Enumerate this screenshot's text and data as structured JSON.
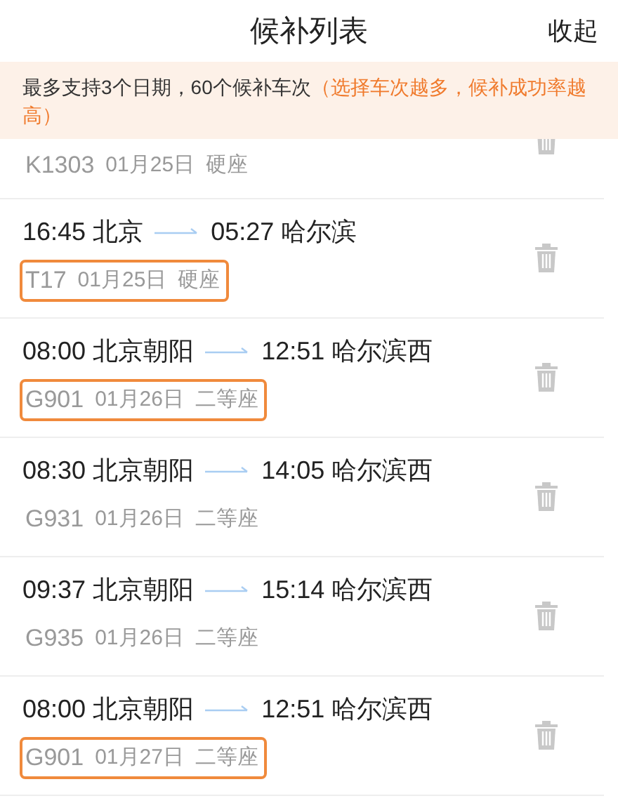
{
  "header": {
    "title": "候补列表",
    "action": "收起"
  },
  "notice": {
    "text": "最多支持3个日期，60个候补车次",
    "hint": "（选择车次越多，候补成功率越高）"
  },
  "trains": [
    {
      "kind": "partial",
      "train": "K1303",
      "date": "01月25日",
      "seat": "硬座",
      "highlighted": false
    },
    {
      "kind": "full",
      "depart_time": "16:45",
      "from": "北京",
      "arrive_time": "05:27",
      "to": "哈尔滨",
      "train": "T17",
      "date": "01月25日",
      "seat": "硬座",
      "highlighted": true
    },
    {
      "kind": "full",
      "depart_time": "08:00",
      "from": "北京朝阳",
      "arrive_time": "12:51",
      "to": "哈尔滨西",
      "train": "G901",
      "date": "01月26日",
      "seat": "二等座",
      "highlighted": true
    },
    {
      "kind": "full",
      "depart_time": "08:30",
      "from": "北京朝阳",
      "arrive_time": "14:05",
      "to": "哈尔滨西",
      "train": "G931",
      "date": "01月26日",
      "seat": "二等座",
      "highlighted": false
    },
    {
      "kind": "full",
      "depart_time": "09:37",
      "from": "北京朝阳",
      "arrive_time": "15:14",
      "to": "哈尔滨西",
      "train": "G935",
      "date": "01月26日",
      "seat": "二等座",
      "highlighted": false
    },
    {
      "kind": "full",
      "depart_time": "08:00",
      "from": "北京朝阳",
      "arrive_time": "12:51",
      "to": "哈尔滨西",
      "train": "G901",
      "date": "01月27日",
      "seat": "二等座",
      "highlighted": true
    }
  ]
}
